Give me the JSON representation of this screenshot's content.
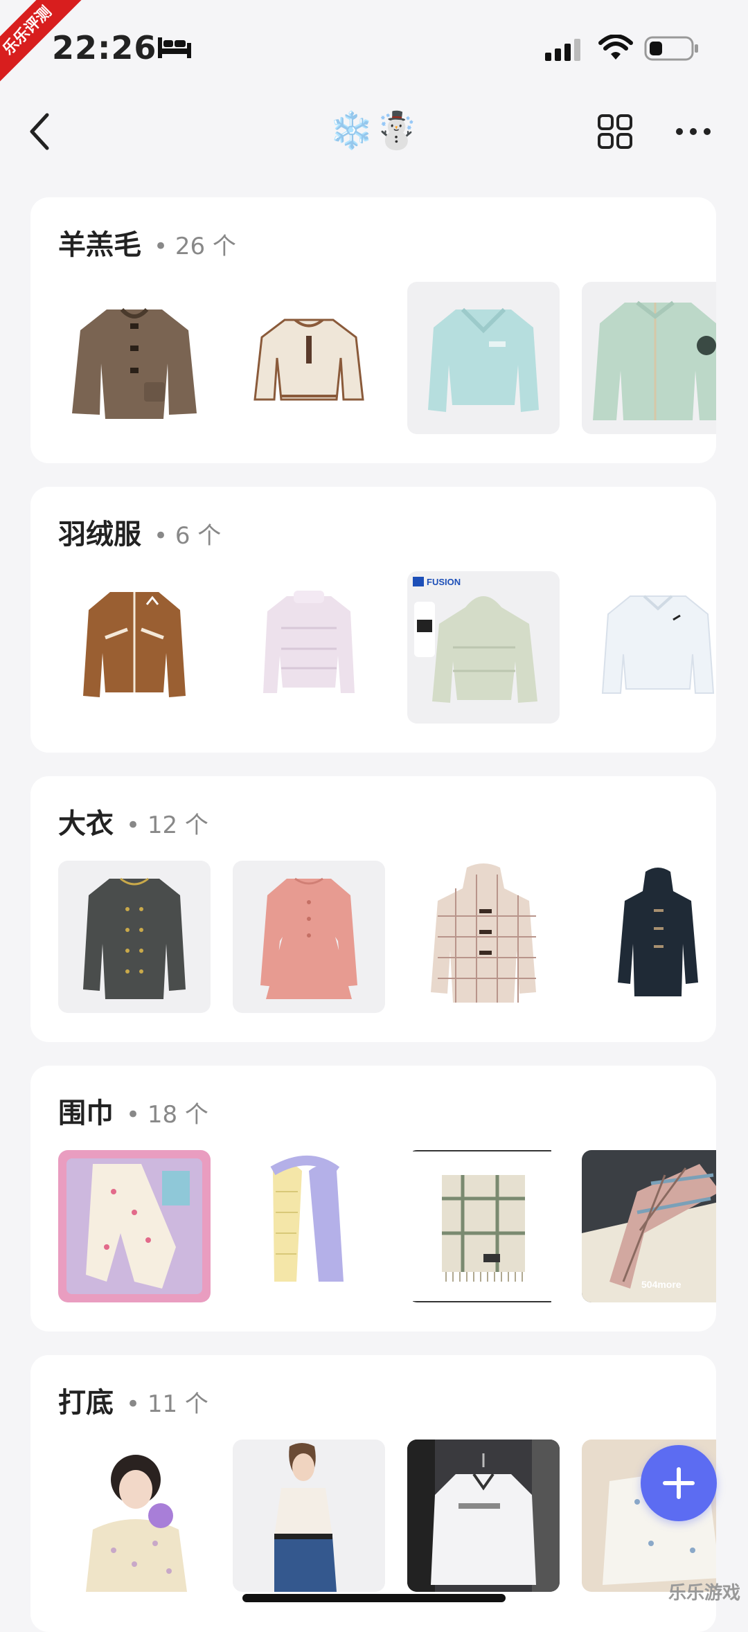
{
  "status_bar": {
    "time": "22:26",
    "ribbon": "乐乐评测"
  },
  "nav": {
    "title": "❄️☃️"
  },
  "sections": [
    {
      "name": "羊羔毛",
      "count": "• 26 个"
    },
    {
      "name": "羽绒服",
      "count": "• 6 个",
      "brand_tag": "FUSION"
    },
    {
      "name": "大衣",
      "count": "• 12 个"
    },
    {
      "name": "围巾",
      "count": "• 18 个",
      "photo_caption": "504more"
    },
    {
      "name": "打底",
      "count": "• 11 个"
    }
  ],
  "watermark": "乐乐游戏",
  "colors": {
    "accent": "#5c6cf2",
    "background": "#f5f5f7",
    "ribbon": "#d81e1e"
  }
}
